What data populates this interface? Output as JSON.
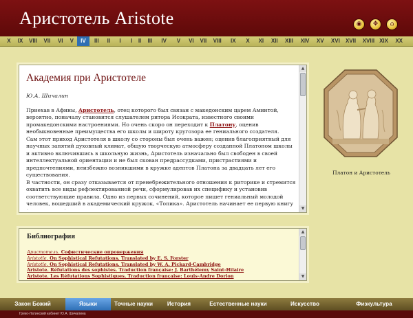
{
  "header": {
    "title": "Аристотель  Aristote",
    "buttons": [
      {
        "icon": "circle-arrow-icon",
        "glyph": "◉"
      },
      {
        "icon": "compass-icon",
        "glyph": "✥"
      },
      {
        "icon": "home-icon",
        "glyph": "⌂"
      }
    ]
  },
  "century_nav": {
    "items": [
      "X",
      "IX",
      "VIII",
      "VII",
      "VI",
      "V",
      "IV",
      "III",
      "II",
      "I",
      "I",
      "II",
      "III",
      "IV",
      "V",
      "VI",
      "VII",
      "VIII",
      "IX",
      "X",
      "XI",
      "XII",
      "XIII",
      "XIV",
      "XV",
      "XVI",
      "XVII",
      "XVIII",
      "XIX",
      "XX"
    ],
    "active": 6
  },
  "article": {
    "title": "Академия при Аристотеле",
    "author": "Ю.А.  Шичалин",
    "paragraphs": [
      [
        {
          "t": "Приехав в Афины, "
        },
        {
          "t": "Аристотель",
          "link": true
        },
        {
          "t": ", отец которого был связан с македонским царем Аминтой, вероятно, поначалу становится слушателем ритора Исократа, известного своими промакедонскими настроениями. Но очень скоро он переходит к "
        },
        {
          "t": "Платону",
          "link": true
        },
        {
          "t": ", оценив необыкновенные преимущества его школы и широту кругозора ее гениального создателя."
        }
      ],
      [
        {
          "t": "Сам этот приход Аристотеля в школу со стороны был очень важен; оценив благоприятный для научных занятий духовный климат, общую творческую атмосферу созданной Платоном школы и активно включившись в школьную жизнь, Аристотель изначально был свободен в своей интеллектуальной ориентации и не был скован предрассудками, пристрастиями и предпочтениями, неизбежно возникшими в кружке адептов Платона за двадцать лет его существования."
        }
      ],
      [
        {
          "t": "В частности, он сразу отказывается от пренебрежительного отношения к риторике и стремится охватить все виды рефлектированной речи, сформулировав их специфику и установив соответствующие правила. Одно из первых сочинений, которое пишет гениальный молодой человек, вошедший в академический кружок, «Топика». Аристотель начинает ее первую книгу (глава первая) с определения умозаключения и его видов; доказательства, или научного умозаключения в строгом смысле слова,"
        }
      ]
    ]
  },
  "image": {
    "caption": "Платон и Аристотель"
  },
  "bibliography": {
    "title": "Библиография",
    "items": [
      {
        "i": "Аристотель.",
        "t": " Софистические опровержения"
      },
      {
        "i": "Aristotle.",
        "t": " On Sophistical Refutations. Translated by E. S. Forster"
      },
      {
        "i": "Aristotle.",
        "t": " On Sophistical Refutations. Translated by W. A. Pickard-Cambridge"
      },
      {
        "i": "",
        "t": "Aristote. Réfutations des sophistes. Traduction française: J. Barthélemy Saint-Hilaire"
      },
      {
        "i": "",
        "t": "Aristote. Les Réfutations Sophistiques. Traduction française: Louis-Andre Dorion"
      }
    ]
  },
  "bottom_nav": {
    "items": [
      "Закон Божий",
      "Языки",
      "Точные науки",
      "История",
      "Естественные  науки",
      "Искусство",
      "Физкультура"
    ],
    "active": 1
  },
  "footer": {
    "text": "Греко-Латинский кабинет Ю.А. Шичалина"
  }
}
